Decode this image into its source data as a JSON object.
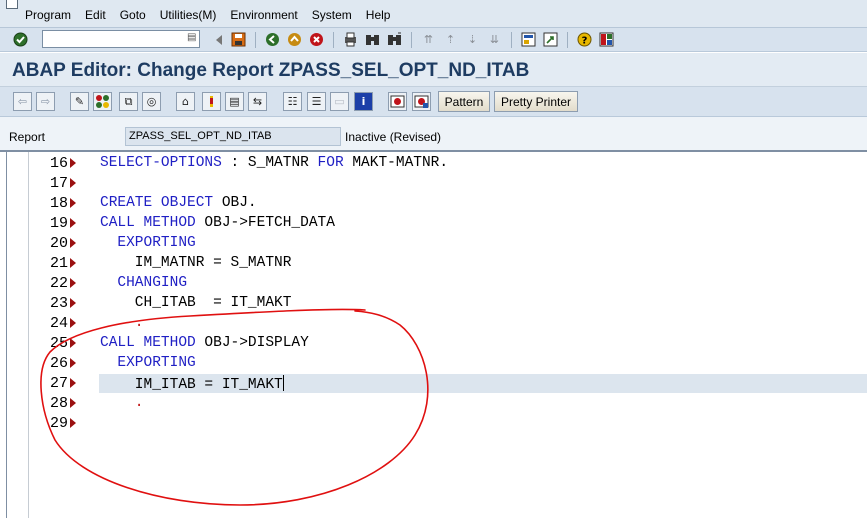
{
  "menubar": {
    "items": [
      "Program",
      "Edit",
      "Goto",
      "Utilities(M)",
      "Environment",
      "System",
      "Help"
    ]
  },
  "system_toolbar": {
    "command_field_value": "",
    "icons": [
      "enter-icon",
      "command-dropdown-icon",
      "back-icon",
      "save-icon",
      "back-green-icon",
      "exit-icon",
      "cancel-icon",
      "print-icon",
      "find-icon",
      "find-next-icon",
      "first-page-icon",
      "previous-page-icon",
      "next-page-icon",
      "last-page-icon",
      "create-session-icon",
      "shortcut-icon",
      "help-icon",
      "layout-icon"
    ]
  },
  "title": "ABAP Editor: Change Report ZPASS_SEL_OPT_ND_ITAB",
  "app_toolbar": {
    "icons": [
      "previous-object-icon",
      "next-object-icon",
      "display-change-icon",
      "active-inactive-icon",
      "other-object-icon",
      "check-icon",
      "activate-icon",
      "test-icon",
      "where-used-icon",
      "navigation-window-icon",
      "object-list-icon",
      "display-object-list-icon",
      "pretty-printer-icon",
      "info-icon",
      "set-breakpoint-icon",
      "session-breakpoint-icon"
    ],
    "pattern_label": "Pattern",
    "pretty_printer_label": "Pretty Printer"
  },
  "report": {
    "label": "Report",
    "value": "ZPASS_SEL_OPT_ND_ITAB",
    "status": "Inactive (Revised)"
  },
  "editor": {
    "lines": [
      {
        "num": "16",
        "segments": [
          {
            "t": "SELECT-OPTIONS",
            "k": true
          },
          {
            "t": " : S_MATNR ",
            "k": false
          },
          {
            "t": "FOR",
            "k": true
          },
          {
            "t": " MAKT-MATNR.",
            "k": false
          }
        ]
      },
      {
        "num": "17",
        "segments": []
      },
      {
        "num": "18",
        "segments": [
          {
            "t": "CREATE OBJECT",
            "k": true
          },
          {
            "t": " OBJ.",
            "k": false
          }
        ]
      },
      {
        "num": "19",
        "segments": [
          {
            "t": "CALL METHOD",
            "k": true
          },
          {
            "t": " OBJ->FETCH_DATA",
            "k": false
          }
        ]
      },
      {
        "num": "20",
        "segments": [
          {
            "t": "  EXPORTING",
            "k": true
          }
        ]
      },
      {
        "num": "21",
        "segments": [
          {
            "t": "    IM_MATNR = S_MATNR",
            "k": false
          }
        ]
      },
      {
        "num": "22",
        "segments": [
          {
            "t": "  CHANGING",
            "k": true
          }
        ]
      },
      {
        "num": "23",
        "segments": [
          {
            "t": "    CH_ITAB  = IT_MAKT",
            "k": false
          }
        ]
      },
      {
        "num": "24",
        "segments": [
          {
            "t": "    .",
            "k": false,
            "red": true
          }
        ]
      },
      {
        "num": "25",
        "segments": [
          {
            "t": "CALL METHOD",
            "k": true
          },
          {
            "t": " OBJ->DISPLAY",
            "k": false
          }
        ]
      },
      {
        "num": "26",
        "segments": [
          {
            "t": "  EXPORTING",
            "k": true
          }
        ]
      },
      {
        "num": "27",
        "segments": [
          {
            "t": "    IM_ITAB = IT_MAKT",
            "k": false
          }
        ],
        "active": true
      },
      {
        "num": "28",
        "segments": [
          {
            "t": "    .",
            "k": false,
            "red": true
          }
        ]
      },
      {
        "num": "29",
        "segments": []
      }
    ]
  },
  "colors": {
    "keyword": "#1f1fc4",
    "title_text": "#1e3c62",
    "annotation": "#e01010",
    "line_marker": "#9b1111"
  }
}
